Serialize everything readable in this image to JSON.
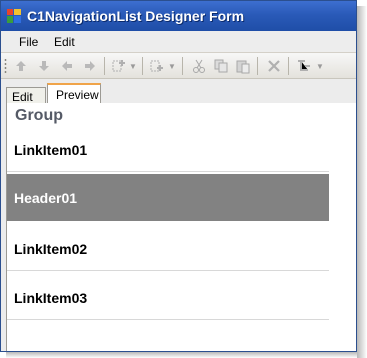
{
  "window": {
    "title": "C1NavigationList Designer Form"
  },
  "menu": {
    "items": [
      "File",
      "Edit"
    ]
  },
  "toolbar": {
    "buttons": [
      "move-up-icon",
      "move-down-icon",
      "move-left-icon",
      "move-right-icon",
      "add-item-icon",
      "insert-item-icon",
      "cut-icon",
      "copy-icon",
      "paste-icon",
      "delete-icon",
      "properties-icon"
    ]
  },
  "tabs": {
    "edit_label": "Edit",
    "preview_label": "Preview",
    "selected": "Preview"
  },
  "preview": {
    "group_label": "Group",
    "items": [
      {
        "label": "LinkItem01",
        "kind": "link"
      },
      {
        "label": "Header01",
        "kind": "header"
      },
      {
        "label": "LinkItem02",
        "kind": "link"
      },
      {
        "label": "LinkItem03",
        "kind": "link"
      }
    ]
  },
  "colors": {
    "title_bar": "#2a5ab8",
    "header_item_bg": "#828282",
    "active_tab_accent": "#f0a44a"
  }
}
